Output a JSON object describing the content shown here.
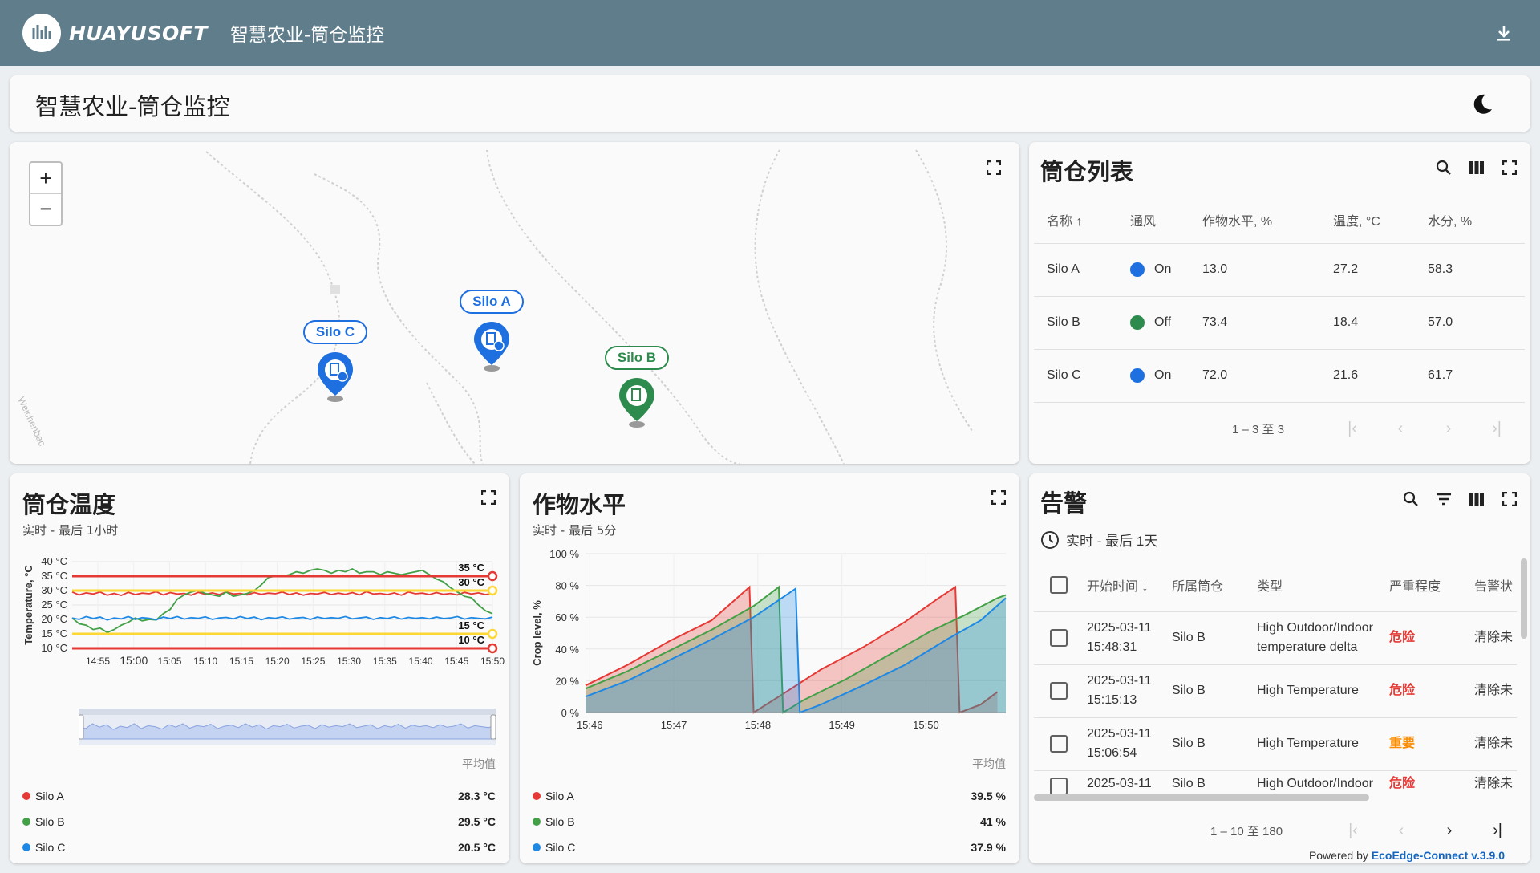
{
  "topbar": {
    "logo_text": "HUAYUSOFT",
    "app_title": "智慧农业-筒仓监控"
  },
  "page_header": {
    "title": "智慧农业-筒仓监控"
  },
  "map": {
    "markers": [
      {
        "label": "Silo C",
        "color": "#1e6fe0"
      },
      {
        "label": "Silo A",
        "color": "#1e6fe0"
      },
      {
        "label": "Silo B",
        "color": "#2e8b4e"
      }
    ],
    "street_label": "Weichenbac"
  },
  "silo_list": {
    "title": "筒仓列表",
    "columns": [
      "名称 ↑",
      "通风",
      "作物水平, %",
      "温度, °C",
      "水分, %"
    ],
    "rows": [
      {
        "name": "Silo A",
        "vent": "On",
        "vent_color": "#1e6fe0",
        "crop": "13.0",
        "temp": "27.2",
        "moist": "58.3"
      },
      {
        "name": "Silo B",
        "vent": "Off",
        "vent_color": "#2e8b4e",
        "crop": "73.4",
        "temp": "18.4",
        "moist": "57.0"
      },
      {
        "name": "Silo C",
        "vent": "On",
        "vent_color": "#1e6fe0",
        "crop": "72.0",
        "temp": "21.6",
        "moist": "61.7"
      }
    ],
    "pager_text": "1 – 3 至 3"
  },
  "temp_chart": {
    "title": "筒仓温度",
    "subtitle": "实时 - 最后 1小时",
    "avg_label": "平均值",
    "legend": [
      {
        "name": "Silo A",
        "color": "#e53935",
        "avg": "28.3 °C"
      },
      {
        "name": "Silo B",
        "color": "#43a047",
        "avg": "29.5 °C"
      },
      {
        "name": "Silo C",
        "color": "#1e88e5",
        "avg": "20.5 °C"
      }
    ]
  },
  "crop_chart": {
    "title": "作物水平",
    "subtitle": "实时 - 最后 5分",
    "avg_label": "平均值",
    "legend": [
      {
        "name": "Silo A",
        "color": "#e53935",
        "avg": "39.5 %"
      },
      {
        "name": "Silo B",
        "color": "#43a047",
        "avg": "41 %"
      },
      {
        "name": "Silo C",
        "color": "#1e88e5",
        "avg": "37.9 %"
      }
    ]
  },
  "alarms": {
    "title": "告警",
    "time_range": "实时 - 最后 1天",
    "columns": [
      "开始时间 ↓",
      "所属筒仓",
      "类型",
      "严重程度",
      "告警状"
    ],
    "rows": [
      {
        "date": "2025-03-11",
        "time": "15:48:31",
        "silo": "Silo B",
        "type1": "High Outdoor/Indoor",
        "type2": "temperature delta",
        "severity": "危险",
        "sev_color": "#e53935",
        "status": "清除未"
      },
      {
        "date": "2025-03-11",
        "time": "15:15:13",
        "silo": "Silo B",
        "type1": "High Temperature",
        "type2": "",
        "severity": "危险",
        "sev_color": "#e53935",
        "status": "清除未"
      },
      {
        "date": "2025-03-11",
        "time": "15:06:54",
        "silo": "Silo B",
        "type1": "High Temperature",
        "type2": "",
        "severity": "重要",
        "sev_color": "#fb8c00",
        "status": "清除未"
      },
      {
        "date": "2025-03-11",
        "time": "",
        "silo": "Silo B",
        "type1": "High Outdoor/Indoor",
        "type2": "",
        "severity": "危险",
        "sev_color": "#e53935",
        "status": "清除未"
      }
    ],
    "pager_text": "1 – 10 至 180"
  },
  "footer": {
    "prefix": "Powered by ",
    "product": "EcoEdge-Connect v.3.9.0"
  },
  "chart_data": [
    {
      "type": "line",
      "title": "筒仓温度",
      "ylabel": "Temperature, °C",
      "ylim": [
        10,
        40
      ],
      "yticks": [
        "10 °C",
        "15 °C",
        "20 °C",
        "25 °C",
        "30 °C",
        "35 °C",
        "40 °C"
      ],
      "xticks": [
        "14:55",
        "15:00",
        "15:05",
        "15:10",
        "15:15",
        "15:20",
        "15:25",
        "15:30",
        "15:35",
        "15:40",
        "15:45",
        "15:50"
      ],
      "thresholds": [
        {
          "value": 35,
          "label": "35 °C",
          "color": "#e53935"
        },
        {
          "value": 30,
          "label": "30 °C",
          "color": "#fdd835"
        },
        {
          "value": 15,
          "label": "15 °C",
          "color": "#fdd835"
        },
        {
          "value": 10,
          "label": "10 °C",
          "color": "#e53935"
        }
      ],
      "series": [
        {
          "name": "Silo A",
          "color": "#e53935",
          "values": [
            29.5,
            28.5,
            29.2,
            28.8,
            29.5,
            28.4,
            29.0,
            28.3,
            29.4,
            28.6,
            29.1,
            28.9,
            29.6,
            28.5,
            29.3,
            28.8,
            29.0,
            28.4,
            29.4,
            28.7,
            29.2,
            28.6,
            29.5,
            28.8,
            29.0,
            28.5,
            29.3,
            28.7,
            29.1,
            28.9,
            29.5,
            28.6,
            29.2,
            28.4,
            29.0,
            28.8,
            29.4,
            28.6,
            29.1,
            28.7,
            29.3,
            28.5,
            29.6,
            28.8,
            29.0,
            28.6,
            29.2,
            28.4,
            29.5,
            28.9,
            29.1,
            28.6,
            29.3,
            28.7,
            29.0,
            28.5,
            29.4,
            28.8,
            29.2,
            28.6,
            29.0
          ]
        },
        {
          "name": "Silo B",
          "color": "#43a047",
          "values": [
            20.5,
            18.5,
            18.0,
            16.5,
            17.0,
            15.5,
            16.5,
            18.0,
            19.0,
            20.5,
            19.5,
            20.0,
            19.8,
            22.0,
            23.5,
            27.0,
            28.5,
            29.5,
            30.0,
            29.0,
            28.5,
            28.0,
            29.5,
            28.0,
            28.5,
            29.0,
            30.0,
            32.0,
            34.5,
            35.0,
            35.0,
            35.5,
            36.5,
            36.0,
            37.0,
            37.5,
            37.0,
            36.0,
            37.0,
            36.5,
            37.5,
            36.0,
            36.5,
            36.5,
            35.5,
            36.5,
            36.0,
            35.5,
            36.0,
            36.5,
            37.0,
            35.5,
            34.0,
            33.0,
            31.0,
            29.5,
            28.0,
            27.5,
            25.0,
            23.0,
            22.0
          ]
        },
        {
          "name": "Silo C",
          "color": "#1e88e5",
          "values": [
            20.5,
            20.0,
            21.0,
            20.3,
            20.8,
            19.8,
            20.5,
            20.2,
            21.0,
            20.0,
            20.6,
            20.4,
            19.9,
            20.8,
            20.3,
            21.0,
            20.1,
            20.6,
            20.4,
            20.9,
            20.0,
            20.5,
            20.7,
            20.2,
            21.0,
            20.3,
            20.8,
            19.9,
            20.6,
            20.4,
            20.9,
            20.1,
            20.5,
            20.7,
            20.0,
            20.8,
            20.3,
            20.6,
            20.4,
            21.0,
            20.2,
            20.5,
            20.8,
            20.0,
            20.6,
            20.3,
            20.9,
            20.1,
            20.7,
            20.4,
            20.6,
            20.2,
            20.8,
            20.3,
            20.5,
            21.0,
            20.1,
            20.6,
            20.4,
            20.2,
            20.8
          ]
        }
      ]
    },
    {
      "type": "area",
      "title": "作物水平",
      "ylabel": "Crop level, %",
      "ylim": [
        0,
        100
      ],
      "yticks": [
        "0 %",
        "20 %",
        "40 %",
        "60 %",
        "80 %",
        "100 %"
      ],
      "xticks": [
        "15:46",
        "15:47",
        "15:48",
        "15:49",
        "15:50"
      ],
      "xlim": [
        0,
        5
      ],
      "series": [
        {
          "name": "Silo A",
          "color": "#e53935",
          "points": [
            [
              0,
              17
            ],
            [
              0.5,
              30
            ],
            [
              1.0,
              45
            ],
            [
              1.5,
              58
            ],
            [
              1.95,
              79
            ],
            [
              2.0,
              0
            ],
            [
              2.3,
              10
            ],
            [
              2.8,
              27
            ],
            [
              3.3,
              41
            ],
            [
              3.8,
              57
            ],
            [
              4.2,
              72
            ],
            [
              4.4,
              79
            ],
            [
              4.45,
              0
            ],
            [
              4.7,
              5
            ],
            [
              4.9,
              13
            ]
          ]
        },
        {
          "name": "Silo B",
          "color": "#43a047",
          "points": [
            [
              0,
              15
            ],
            [
              0.5,
              26
            ],
            [
              1.0,
              39
            ],
            [
              1.5,
              52
            ],
            [
              2.0,
              67
            ],
            [
              2.3,
              79
            ],
            [
              2.35,
              0
            ],
            [
              2.6,
              8
            ],
            [
              3.1,
              21
            ],
            [
              3.6,
              36
            ],
            [
              4.1,
              51
            ],
            [
              4.5,
              61
            ],
            [
              4.9,
              72
            ],
            [
              5.0,
              74
            ]
          ]
        },
        {
          "name": "Silo C",
          "color": "#1e88e5",
          "points": [
            [
              0,
              10
            ],
            [
              0.5,
              20
            ],
            [
              1.0,
              33
            ],
            [
              1.5,
              46
            ],
            [
              2.0,
              60
            ],
            [
              2.5,
              78
            ],
            [
              2.55,
              0
            ],
            [
              2.8,
              5
            ],
            [
              3.3,
              17
            ],
            [
              3.8,
              30
            ],
            [
              4.3,
              46
            ],
            [
              4.7,
              58
            ],
            [
              5.0,
              72
            ]
          ]
        }
      ]
    }
  ]
}
